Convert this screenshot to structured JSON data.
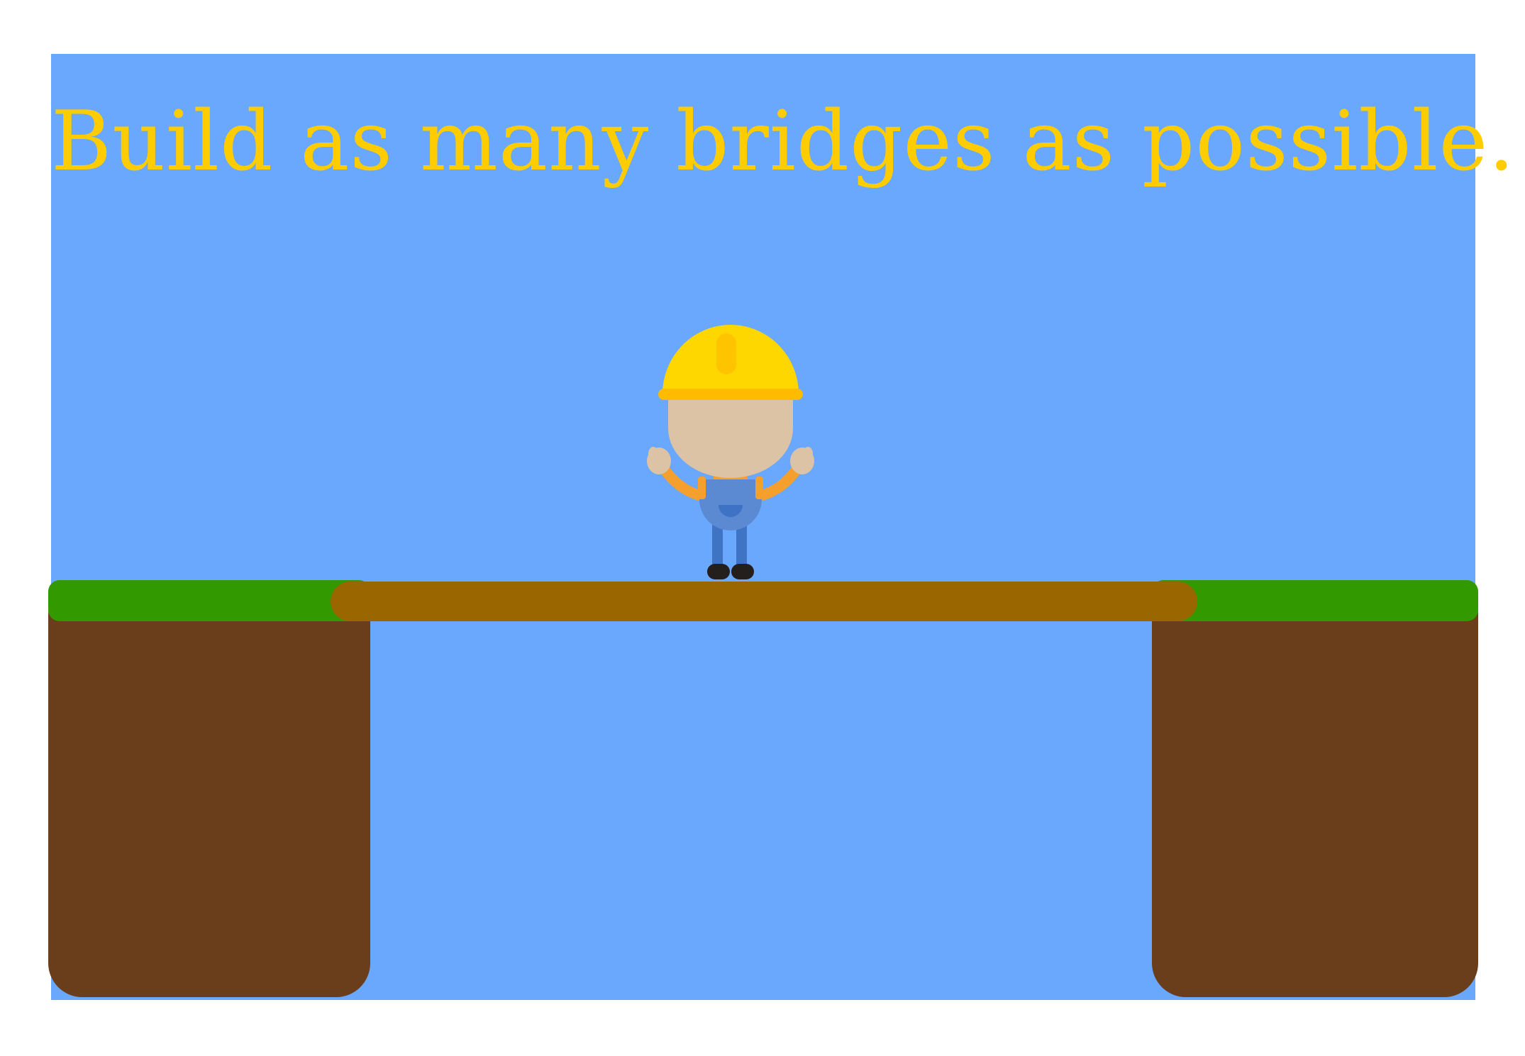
{
  "headline": {
    "text": "Build as many bridges as possible."
  },
  "colors": {
    "page_background": "#ffffff",
    "sky": "#6aa8fd",
    "headline_text": "#ffcc00",
    "grass": "#339900",
    "cliff_dirt": "#6b3e1b",
    "bridge_plank": "#996600",
    "helmet": "#ffd700",
    "helmet_brim": "#ffbb00",
    "skin": "#dcc3a6",
    "shirt_arms": "#f5a02c",
    "overalls": "#5b8ad3",
    "overalls_dark": "#3d72c5",
    "legs": "#3f73c4",
    "shoes": "#241f1c"
  },
  "icons": {
    "character": "construction-worker-icon",
    "helmet": "hard-hat-icon"
  }
}
